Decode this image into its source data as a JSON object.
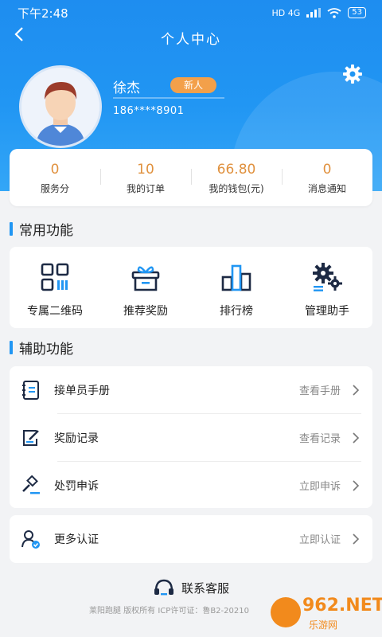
{
  "status_bar": {
    "time": "下午2:48",
    "network": "HD 4G",
    "battery": "53"
  },
  "nav": {
    "title": "个人中心"
  },
  "profile": {
    "name": "徐杰",
    "badge": "新人",
    "phone": "186****8901"
  },
  "stats": [
    {
      "value": "0",
      "label": "服务分"
    },
    {
      "value": "10",
      "label": "我的订单"
    },
    {
      "value": "66.80",
      "label": "我的钱包(元)"
    },
    {
      "value": "0",
      "label": "消息通知"
    }
  ],
  "common": {
    "title": "常用功能",
    "items": [
      {
        "label": "专属二维码",
        "icon": "qrcode-icon"
      },
      {
        "label": "推荐奖励",
        "icon": "gift-icon"
      },
      {
        "label": "排行榜",
        "icon": "ranking-icon"
      },
      {
        "label": "管理助手",
        "icon": "gears-icon"
      }
    ]
  },
  "aux": {
    "title": "辅助功能",
    "items": [
      {
        "label": "接单员手册",
        "action": "查看手册",
        "icon": "manual-icon"
      },
      {
        "label": "奖励记录",
        "action": "查看记录",
        "icon": "edit-record-icon"
      },
      {
        "label": "处罚申诉",
        "action": "立即申诉",
        "icon": "gavel-icon"
      }
    ],
    "more": {
      "label": "更多认证",
      "action": "立即认证",
      "icon": "user-verify-icon"
    }
  },
  "footer": {
    "contact": "联系客服",
    "copyright": "莱阳跑腿 版权所有 ICP许可证：鲁B2-20210"
  },
  "watermark": {
    "text": "962.NET",
    "sub": "乐游网"
  },
  "colors": {
    "primary": "#2196f3",
    "accent": "#e0913e",
    "badge": "#f3a04a"
  }
}
